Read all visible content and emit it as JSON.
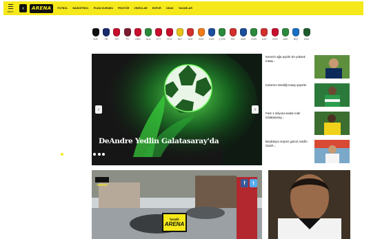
{
  "header": {
    "menu_label": "MENÜ",
    "back_icon": "chevron-left-icon",
    "logo_text": "ARENA",
    "nav": [
      "FUTBOL",
      "BASKETBOL",
      "PUAN DURUMU",
      "FİKSTÜR",
      "VİDEOLAR",
      "ESPOR",
      "ODAK",
      "YAZARLAR"
    ]
  },
  "teams": [
    {
      "code": "BJK",
      "color": "#111111"
    },
    {
      "code": "FB",
      "color": "#1a2b6d"
    },
    {
      "code": "GS",
      "color": "#c8102e"
    },
    {
      "code": "TS",
      "color": "#7b1e2f"
    },
    {
      "code": "OBS",
      "color": "#c8102e"
    },
    {
      "code": "ALA",
      "color": "#2c8a3c"
    },
    {
      "code": "KTY",
      "color": "#c8102e"
    },
    {
      "code": "FKG",
      "color": "#c8102e"
    },
    {
      "code": "MLT",
      "color": "#e8c41a"
    },
    {
      "code": "ANT",
      "color": "#d32f2f"
    },
    {
      "code": "GÖZ",
      "color": "#f07d1a"
    },
    {
      "code": "KAS",
      "color": "#1a4f9c"
    },
    {
      "code": "Ç.RİZ",
      "color": "#2c8a3c"
    },
    {
      "code": "SİV",
      "color": "#d32f2f"
    },
    {
      "code": "BAS",
      "color": "#1a4f9c"
    },
    {
      "code": "KON",
      "color": "#2c8a3c"
    },
    {
      "code": "KAY",
      "color": "#d32f2f"
    },
    {
      "code": "GEN",
      "color": "#c8102e"
    },
    {
      "code": "AKE",
      "color": "#2c8a3c"
    },
    {
      "code": "BŞT",
      "color": "#1a6fc4"
    },
    {
      "code": "DNZ",
      "color": "#1e5c2e"
    }
  ],
  "hero": {
    "title": "DeAndre Yedlin Galatasaray'da",
    "slide_count": 10,
    "active_slide": 1
  },
  "side_news": [
    {
      "text": "Keserin ağa açıldı! En yüksek maaş...",
      "thumb": "player-portrait"
    },
    {
      "text": "Koita'nın istediği maaş şaşırttı!",
      "thumb": "player-green-kit"
    },
    {
      "text": "Fark 1 milyona kadar indi! Galatasaray...",
      "thumb": "player-yellow-kit"
    },
    {
      "text": "Beşiktaş'a sürpriz golcü! Adolfo Gaich...",
      "thumb": "player-stadium"
    }
  ],
  "video": {
    "logo_text": "ARENA",
    "mic_top": "fanatik",
    "mic_bottom": "ARENA",
    "facebook": "f",
    "twitter": "t"
  },
  "colors": {
    "accent": "#f5e81b",
    "dark": "#111111"
  }
}
